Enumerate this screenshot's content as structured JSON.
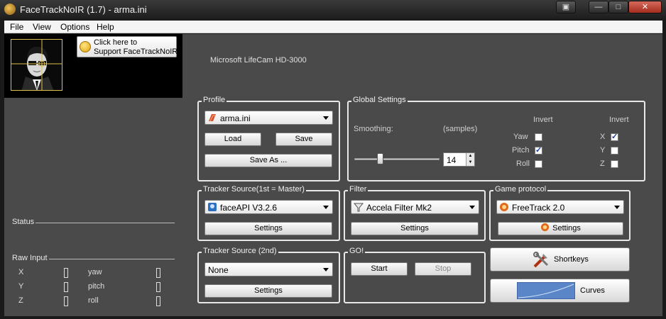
{
  "window": {
    "title": "FaceTrackNoIR (1.7) - arma.ini"
  },
  "menu": [
    "File",
    "View",
    "Options",
    "Help"
  ],
  "support_button": {
    "line1": "Click here to",
    "line2": "Support FaceTrackNoIR"
  },
  "camera_name": "Microsoft LifeCam HD-3000",
  "status": {
    "label": "Status"
  },
  "raw_input": {
    "label": "Raw Input",
    "rows": [
      {
        "axis": "X",
        "rot": "yaw"
      },
      {
        "axis": "Y",
        "rot": "pitch"
      },
      {
        "axis": "Z",
        "rot": "roll"
      }
    ]
  },
  "profile": {
    "legend": "Profile",
    "selected": "arma.ini",
    "load": "Load",
    "save": "Save",
    "save_as": "Save As ..."
  },
  "global_settings": {
    "legend": "Global Settings",
    "smoothing_label": "Smoothing:",
    "samples_label": "(samples)",
    "smoothing_value": "14",
    "smoothing_fraction": 0.3,
    "invert_header": "Invert",
    "rot_axes": [
      {
        "label": "Yaw",
        "checked": false
      },
      {
        "label": "Pitch",
        "checked": true
      },
      {
        "label": "Roll",
        "checked": false
      }
    ],
    "pos_axes": [
      {
        "label": "X",
        "checked": true
      },
      {
        "label": "Y",
        "checked": false
      },
      {
        "label": "Z",
        "checked": false
      }
    ]
  },
  "tracker_source": {
    "legend": "Tracker Source(1st = Master)",
    "selected": "faceAPI V3.2.6",
    "settings": "Settings"
  },
  "filter": {
    "legend": "Filter",
    "selected": "Accela Filter Mk2",
    "settings": "Settings"
  },
  "game_protocol": {
    "legend": "Game protocol",
    "selected": "FreeTrack 2.0",
    "settings": "Settings"
  },
  "tracker_source_2nd": {
    "legend": "Tracker Source (2nd)",
    "selected": "None",
    "settings": "Settings"
  },
  "go": {
    "legend": "GO!",
    "start": "Start",
    "stop": "Stop"
  },
  "shortkeys": {
    "label": "Shortkeys"
  },
  "curves": {
    "label": "Curves"
  },
  "colors": {
    "panel": "#4a4a4a",
    "frame": "#e8e8e8",
    "curve_blue": "#5a86c8"
  }
}
